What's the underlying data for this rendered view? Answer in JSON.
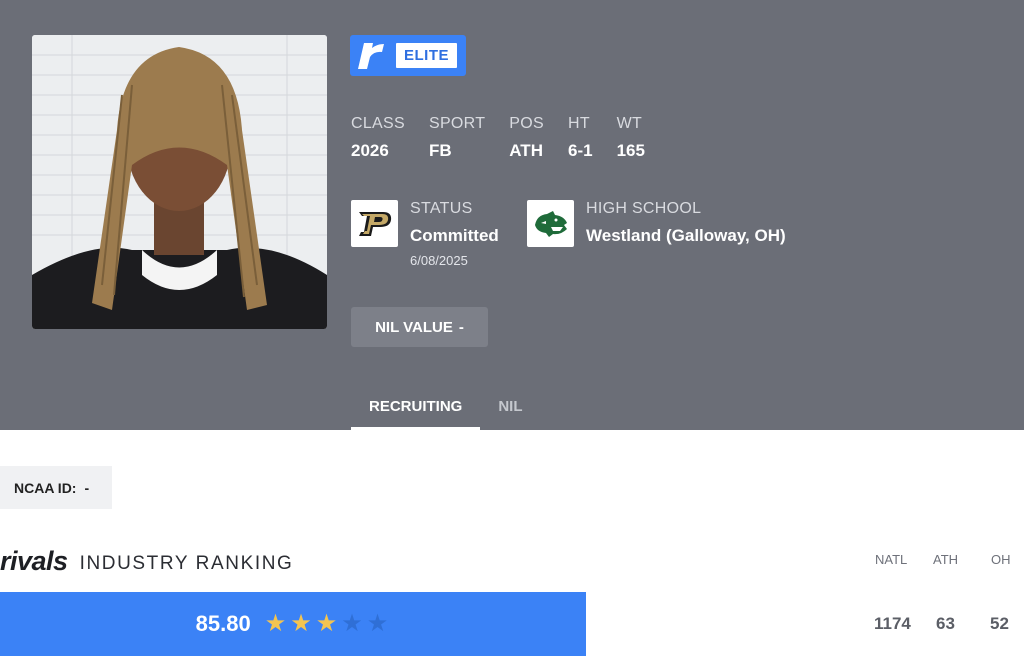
{
  "badge": {
    "logo_letter": "r",
    "label": "ELITE"
  },
  "stats": [
    {
      "key": "CLASS",
      "value": "2026"
    },
    {
      "key": "SPORT",
      "value": "FB"
    },
    {
      "key": "POS",
      "value": "ATH"
    },
    {
      "key": "HT",
      "value": "6-1"
    },
    {
      "key": "WT",
      "value": "165"
    }
  ],
  "status": {
    "label": "STATUS",
    "value": "Committed",
    "date": "6/08/2025"
  },
  "high_school": {
    "label": "HIGH SCHOOL",
    "value": "Westland (Galloway, OH)"
  },
  "nil_button": {
    "label": "NIL VALUE",
    "value": "-"
  },
  "tabs": [
    {
      "label": "RECRUITING",
      "active": true
    },
    {
      "label": "NIL",
      "active": false
    }
  ],
  "ncaa": {
    "label": "NCAA ID:",
    "value": "-"
  },
  "ranking": {
    "brand": "rivals",
    "title": "INDUSTRY RANKING",
    "columns": [
      "NATL",
      "ATH",
      "OH"
    ],
    "score": "85.80",
    "stars": 3,
    "stars_total": 5,
    "values": [
      "1174",
      "63",
      "52"
    ]
  },
  "colors": {
    "header_bg": "#6b6e77",
    "accent_blue": "#3b82f6",
    "star_gold": "#f3c451",
    "star_empty": "#2f6fd6"
  }
}
